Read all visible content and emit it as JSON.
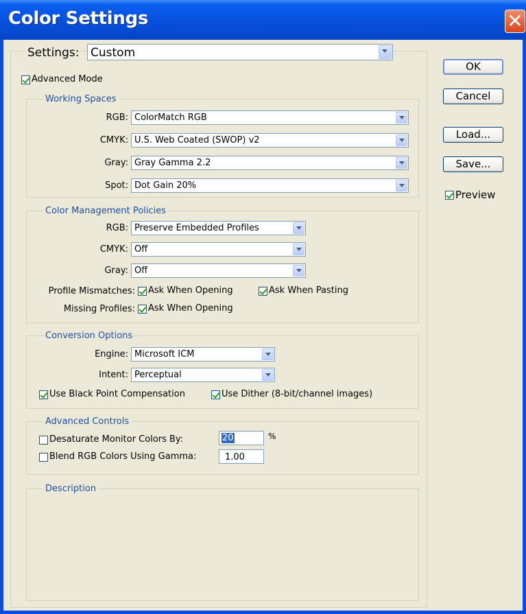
{
  "window": {
    "title": "Color Settings",
    "close_icon": "close-icon"
  },
  "settings": {
    "label": "Settings:",
    "value": "Custom"
  },
  "advanced_mode": {
    "label": "Advanced Mode",
    "checked": true
  },
  "working_spaces": {
    "title": "Working Spaces",
    "rgb_label": "RGB:",
    "rgb_value": "ColorMatch RGB",
    "cmyk_label": "CMYK:",
    "cmyk_value": "U.S. Web Coated (SWOP) v2",
    "gray_label": "Gray:",
    "gray_value": "Gray Gamma 2.2",
    "spot_label": "Spot:",
    "spot_value": "Dot Gain 20%"
  },
  "policies": {
    "title": "Color Management Policies",
    "rgb_label": "RGB:",
    "rgb_value": "Preserve Embedded Profiles",
    "cmyk_label": "CMYK:",
    "cmyk_value": "Off",
    "gray_label": "Gray:",
    "gray_value": "Off",
    "mismatch_label": "Profile Mismatches:",
    "mismatch_opening": "Ask When Opening",
    "mismatch_pasting": "Ask When Pasting",
    "missing_label": "Missing Profiles:",
    "missing_opening": "Ask When Opening"
  },
  "conversion": {
    "title": "Conversion Options",
    "engine_label": "Engine:",
    "engine_value": "Microsoft ICM",
    "intent_label": "Intent:",
    "intent_value": "Perceptual",
    "black_point": "Use Black Point Compensation",
    "dither": "Use Dither (8-bit/channel images)"
  },
  "advanced_controls": {
    "title": "Advanced Controls",
    "desaturate_label": "Desaturate Monitor Colors By:",
    "desaturate_value": "20",
    "desaturate_unit": "%",
    "blend_label": "Blend RGB Colors Using Gamma:",
    "blend_value": "1.00"
  },
  "description": {
    "title": "Description"
  },
  "buttons": {
    "ok": "OK",
    "cancel": "Cancel",
    "load": "Load...",
    "save": "Save..."
  },
  "preview": {
    "label": "Preview",
    "checked": true
  }
}
